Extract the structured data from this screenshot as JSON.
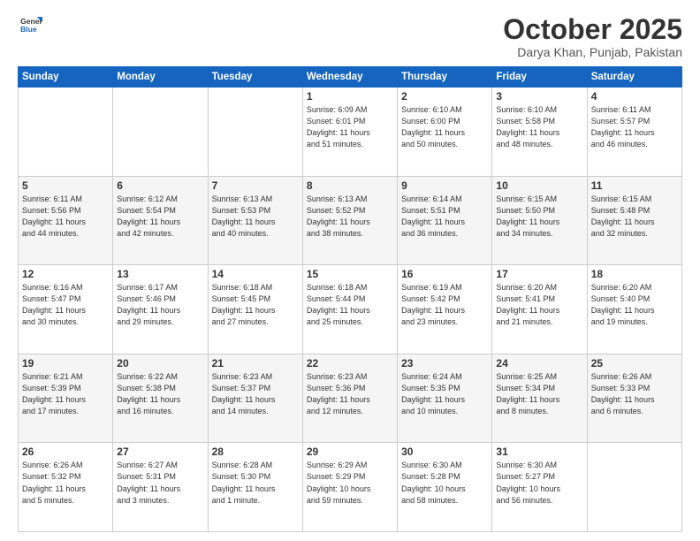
{
  "header": {
    "logo_general": "General",
    "logo_blue": "Blue",
    "month_title": "October 2025",
    "subtitle": "Darya Khan, Punjab, Pakistan"
  },
  "days_of_week": [
    "Sunday",
    "Monday",
    "Tuesday",
    "Wednesday",
    "Thursday",
    "Friday",
    "Saturday"
  ],
  "weeks": [
    [
      {
        "day": "",
        "info": ""
      },
      {
        "day": "",
        "info": ""
      },
      {
        "day": "",
        "info": ""
      },
      {
        "day": "1",
        "info": "Sunrise: 6:09 AM\nSunset: 6:01 PM\nDaylight: 11 hours\nand 51 minutes."
      },
      {
        "day": "2",
        "info": "Sunrise: 6:10 AM\nSunset: 6:00 PM\nDaylight: 11 hours\nand 50 minutes."
      },
      {
        "day": "3",
        "info": "Sunrise: 6:10 AM\nSunset: 5:58 PM\nDaylight: 11 hours\nand 48 minutes."
      },
      {
        "day": "4",
        "info": "Sunrise: 6:11 AM\nSunset: 5:57 PM\nDaylight: 11 hours\nand 46 minutes."
      }
    ],
    [
      {
        "day": "5",
        "info": "Sunrise: 6:11 AM\nSunset: 5:56 PM\nDaylight: 11 hours\nand 44 minutes."
      },
      {
        "day": "6",
        "info": "Sunrise: 6:12 AM\nSunset: 5:54 PM\nDaylight: 11 hours\nand 42 minutes."
      },
      {
        "day": "7",
        "info": "Sunrise: 6:13 AM\nSunset: 5:53 PM\nDaylight: 11 hours\nand 40 minutes."
      },
      {
        "day": "8",
        "info": "Sunrise: 6:13 AM\nSunset: 5:52 PM\nDaylight: 11 hours\nand 38 minutes."
      },
      {
        "day": "9",
        "info": "Sunrise: 6:14 AM\nSunset: 5:51 PM\nDaylight: 11 hours\nand 36 minutes."
      },
      {
        "day": "10",
        "info": "Sunrise: 6:15 AM\nSunset: 5:50 PM\nDaylight: 11 hours\nand 34 minutes."
      },
      {
        "day": "11",
        "info": "Sunrise: 6:15 AM\nSunset: 5:48 PM\nDaylight: 11 hours\nand 32 minutes."
      }
    ],
    [
      {
        "day": "12",
        "info": "Sunrise: 6:16 AM\nSunset: 5:47 PM\nDaylight: 11 hours\nand 30 minutes."
      },
      {
        "day": "13",
        "info": "Sunrise: 6:17 AM\nSunset: 5:46 PM\nDaylight: 11 hours\nand 29 minutes."
      },
      {
        "day": "14",
        "info": "Sunrise: 6:18 AM\nSunset: 5:45 PM\nDaylight: 11 hours\nand 27 minutes."
      },
      {
        "day": "15",
        "info": "Sunrise: 6:18 AM\nSunset: 5:44 PM\nDaylight: 11 hours\nand 25 minutes."
      },
      {
        "day": "16",
        "info": "Sunrise: 6:19 AM\nSunset: 5:42 PM\nDaylight: 11 hours\nand 23 minutes."
      },
      {
        "day": "17",
        "info": "Sunrise: 6:20 AM\nSunset: 5:41 PM\nDaylight: 11 hours\nand 21 minutes."
      },
      {
        "day": "18",
        "info": "Sunrise: 6:20 AM\nSunset: 5:40 PM\nDaylight: 11 hours\nand 19 minutes."
      }
    ],
    [
      {
        "day": "19",
        "info": "Sunrise: 6:21 AM\nSunset: 5:39 PM\nDaylight: 11 hours\nand 17 minutes."
      },
      {
        "day": "20",
        "info": "Sunrise: 6:22 AM\nSunset: 5:38 PM\nDaylight: 11 hours\nand 16 minutes."
      },
      {
        "day": "21",
        "info": "Sunrise: 6:23 AM\nSunset: 5:37 PM\nDaylight: 11 hours\nand 14 minutes."
      },
      {
        "day": "22",
        "info": "Sunrise: 6:23 AM\nSunset: 5:36 PM\nDaylight: 11 hours\nand 12 minutes."
      },
      {
        "day": "23",
        "info": "Sunrise: 6:24 AM\nSunset: 5:35 PM\nDaylight: 11 hours\nand 10 minutes."
      },
      {
        "day": "24",
        "info": "Sunrise: 6:25 AM\nSunset: 5:34 PM\nDaylight: 11 hours\nand 8 minutes."
      },
      {
        "day": "25",
        "info": "Sunrise: 6:26 AM\nSunset: 5:33 PM\nDaylight: 11 hours\nand 6 minutes."
      }
    ],
    [
      {
        "day": "26",
        "info": "Sunrise: 6:26 AM\nSunset: 5:32 PM\nDaylight: 11 hours\nand 5 minutes."
      },
      {
        "day": "27",
        "info": "Sunrise: 6:27 AM\nSunset: 5:31 PM\nDaylight: 11 hours\nand 3 minutes."
      },
      {
        "day": "28",
        "info": "Sunrise: 6:28 AM\nSunset: 5:30 PM\nDaylight: 11 hours\nand 1 minute."
      },
      {
        "day": "29",
        "info": "Sunrise: 6:29 AM\nSunset: 5:29 PM\nDaylight: 10 hours\nand 59 minutes."
      },
      {
        "day": "30",
        "info": "Sunrise: 6:30 AM\nSunset: 5:28 PM\nDaylight: 10 hours\nand 58 minutes."
      },
      {
        "day": "31",
        "info": "Sunrise: 6:30 AM\nSunset: 5:27 PM\nDaylight: 10 hours\nand 56 minutes."
      },
      {
        "day": "",
        "info": ""
      }
    ]
  ]
}
